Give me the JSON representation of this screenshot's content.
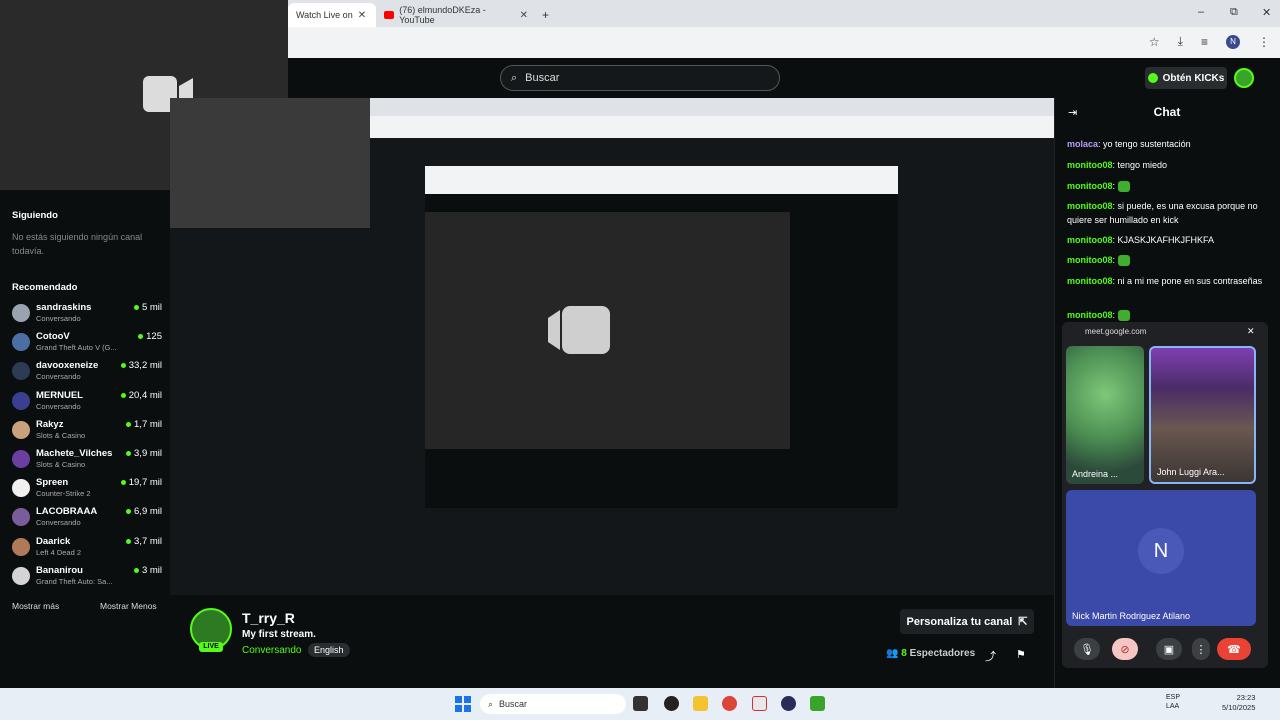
{
  "browser": {
    "tabs": [
      {
        "label": "Watch Live on",
        "active": true
      },
      {
        "label": "(76) elmundoDKEza - YouTube",
        "active": false
      }
    ],
    "new_tab": "+",
    "controls": [
      "–",
      "⧉",
      "✕"
    ]
  },
  "kick": {
    "search_placeholder": "Buscar",
    "kicks_button": "Obtén KICKs"
  },
  "sidebar": {
    "following_title": "Siguiendo",
    "following_empty": "No estás siguiendo ningún canal todavía.",
    "recommended_title": "Recomendado",
    "items": [
      {
        "name": "sandraskins",
        "category": "Conversando",
        "viewers": "5 mil",
        "color": "#9aa4b1"
      },
      {
        "name": "CotooV",
        "category": "Grand Theft Auto V (G...",
        "viewers": "125",
        "color": "#4a6fa5"
      },
      {
        "name": "davooxeneize",
        "category": "Conversando",
        "viewers": "33,2 mil",
        "color": "#2e3b55"
      },
      {
        "name": "MERNUEL",
        "category": "Conversando",
        "viewers": "20,4 mil",
        "color": "#3a3f8f"
      },
      {
        "name": "Rakyz",
        "category": "Slots & Casino",
        "viewers": "1,7 mil",
        "color": "#c9a27c"
      },
      {
        "name": "Machete_Vilches",
        "category": "Slots & Casino",
        "viewers": "3,9 mil",
        "color": "#6a3fa0"
      },
      {
        "name": "Spreen",
        "category": "Counter-Strike 2",
        "viewers": "19,7 mil",
        "color": "#f0f0f0"
      },
      {
        "name": "LACOBRAAA",
        "category": "Conversando",
        "viewers": "6,9 mil",
        "color": "#7a5c9a"
      },
      {
        "name": "Daarick",
        "category": "Left 4 Dead 2",
        "viewers": "3,7 mil",
        "color": "#b07a5a"
      },
      {
        "name": "Bananirou",
        "category": "Grand Theft Auto: Sa...",
        "viewers": "3 mil",
        "color": "#d4d4d4"
      }
    ],
    "show_more": "Mostrar más",
    "show_less": "Mostrar Menos"
  },
  "stream": {
    "streamer": "T_rry_R",
    "title": "My first stream.",
    "category": "Conversando",
    "language": "English",
    "live_badge": "LIVE",
    "customize_button": "Personaliza tu canal",
    "viewers_count": "8",
    "viewers_label": "Espectadores"
  },
  "chat": {
    "title": "Chat",
    "messages": [
      {
        "user": "molaca",
        "text": "yo tengo sustentación",
        "color": "green"
      },
      {
        "user": "monitoo08",
        "text": "tengo miedo",
        "color": "purple"
      },
      {
        "user": "monitoo08",
        "text": "",
        "color": "purple",
        "emote": true
      },
      {
        "user": "monitoo08",
        "text": "si puede, es una excusa porque no quiere ser humillado en kick",
        "color": "purple"
      },
      {
        "user": "monitoo08",
        "text": "KJASKJKAFHKJFHKFA",
        "color": "purple"
      },
      {
        "user": "monitoo08",
        "text": "",
        "color": "purple",
        "emote": true
      },
      {
        "user": "monitoo08",
        "text": "ni a mi me pone en sus contraseñas",
        "color": "purple"
      },
      {
        "user": "monitoo08",
        "text": "",
        "color": "purple",
        "emote": true
      }
    ]
  },
  "meet": {
    "url": "meet.google.com",
    "participants": [
      {
        "name": "Andreina ..."
      },
      {
        "name": "John Luggi Ara..."
      },
      {
        "name": "Nick Martin Rodriguez Atilano",
        "initial": "N"
      }
    ]
  },
  "taskbar": {
    "search": "Buscar",
    "lang": "ESP",
    "lang_sub": "LAA",
    "time": "23:23",
    "date": "5/10/2025"
  }
}
